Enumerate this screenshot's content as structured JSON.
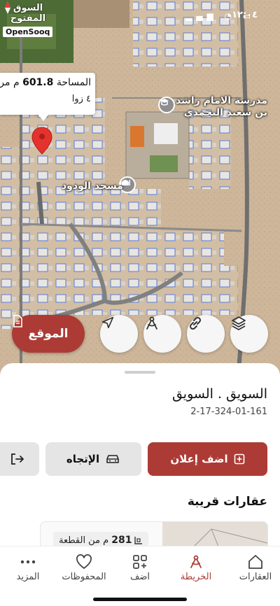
{
  "status_bar": {
    "time": "١٢:٠٤",
    "icons": [
      "signal-icon",
      "wifi-icon",
      "battery-icon"
    ]
  },
  "watermark": {
    "arabic": "السوق المفتوح",
    "english": "OpenSooq"
  },
  "map": {
    "plot_info": {
      "area_label": "المساحة",
      "area_value": "601.8",
      "area_unit": "م مر",
      "corners": "٤ زوا"
    },
    "labels": {
      "school": "مدرسة الامام راشد\nبن سعيد اليحمدي",
      "mosque": "مسجد الودود"
    },
    "buttons": {
      "location_label": "الموقع"
    }
  },
  "sheet": {
    "title": "السويق . السويق",
    "code": "2-17-324-01-161",
    "add_listing_label": "اضف إعلان",
    "directions_label": "الإتجاه",
    "nearby_title": "عقارات قريبة",
    "nearby_card": {
      "area_value": "281",
      "area_text": "م من القطعة"
    }
  },
  "nav": {
    "items": [
      {
        "label": "العقارات",
        "icon": "home-icon"
      },
      {
        "label": "الخريطة",
        "icon": "map-icon"
      },
      {
        "label": "اضف",
        "icon": "add-grid-icon"
      },
      {
        "label": "المحفوظات",
        "icon": "heart-icon"
      },
      {
        "label": "المزيد",
        "icon": "more-icon"
      }
    ],
    "active_index": 1
  },
  "colors": {
    "accent": "#ad3b35",
    "button_gray": "#e5e5e5"
  }
}
